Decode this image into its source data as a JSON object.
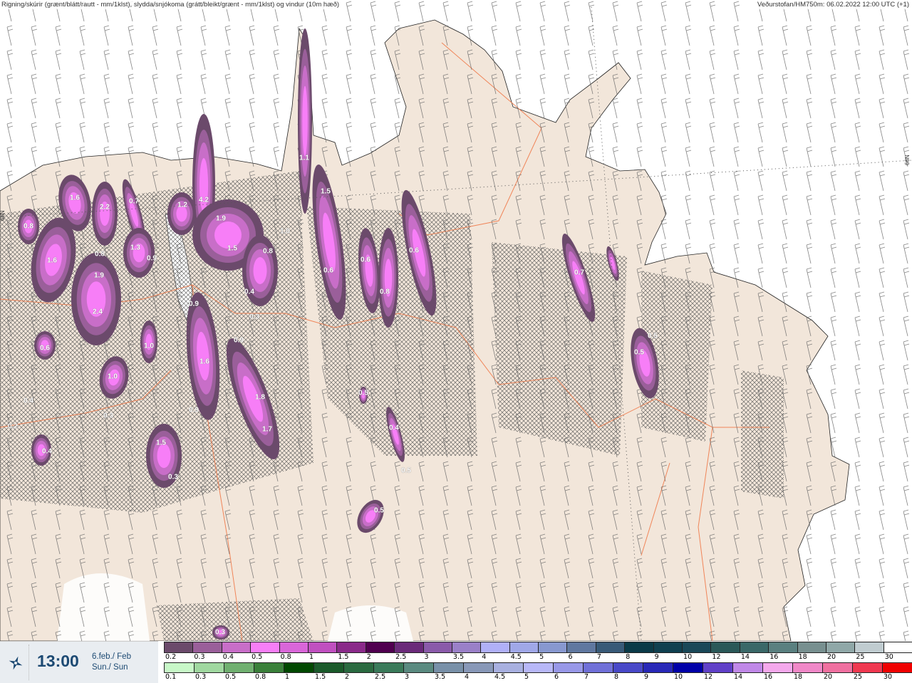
{
  "header": {
    "title": "Rigning/skúrir (grænt/blátt/rautt - mm/1klst), slydda/snjókoma (grátt/bleikt/grænt - mm/1klst) og vindur (10m hæð)",
    "source": "Veðurstofan/HM750m: 06.02.2022 12:00 UTC (+1)"
  },
  "map": {
    "lat_label_left": "66N",
    "lat_label_right": "66N",
    "colors": {
      "land": "#f2e6da",
      "sea": "#ffffff",
      "roads": "#f07a4a",
      "coast": "#222222"
    },
    "precip_values": [
      "1.6",
      "2.2",
      "0.7",
      "1.2",
      "4.2",
      "1.9",
      "0.8",
      "1.3",
      "0.9",
      "1.5",
      "0.8",
      "1.6",
      "0.8",
      "1.9",
      "2.4",
      "0.4",
      "0.3",
      "0.9",
      "0.9",
      "0.6",
      "1.0",
      "1.6",
      "1.0",
      "0.9",
      "1.8",
      "1.7",
      "0.3",
      "0.4",
      "0.2",
      "0.4",
      "1.5",
      "0.3",
      "1.1",
      "1.5",
      "1.0",
      "0.6",
      "0.6",
      "0.8",
      "0.6",
      "0.7",
      "0.5",
      "0.5",
      "0.5",
      "0.4",
      "0.5",
      "0.5",
      "0.3"
    ]
  },
  "panel": {
    "icon": "compass-star-icon",
    "time": "13:00",
    "date_line1": "6.feb./ Feb",
    "date_line2": "Sun./ Sun"
  },
  "legend": {
    "snow": {
      "labels": [
        "0.2",
        "0.3",
        "0.4",
        "0.5",
        "0.8",
        "1",
        "1.5",
        "2",
        "2.5",
        "3",
        "3.5",
        "4",
        "4.5",
        "5",
        "6",
        "7",
        "8",
        "9",
        "10",
        "12",
        "14",
        "16",
        "18",
        "20",
        "25",
        "30"
      ],
      "colors": [
        "#6b4a6b",
        "#9a5f9a",
        "#c86ec8",
        "#f77ef7",
        "#d966d9",
        "#c050c0",
        "#8a2a8a",
        "#500050",
        "#6a2a7a",
        "#8a5aaa",
        "#9a80c8",
        "#b0b0f8",
        "#a0a8e8",
        "#8898d0",
        "#6078a0",
        "#385a78",
        "#0a3a48",
        "#104050",
        "#1a4858",
        "#2a5858",
        "#3a6868",
        "#5a8080",
        "#789090",
        "#90a8a8",
        "#c0ccd0",
        "#ffffff"
      ]
    },
    "rain": {
      "labels": [
        "0.1",
        "0.3",
        "0.5",
        "0.8",
        "1",
        "1.5",
        "2",
        "2.5",
        "3",
        "3.5",
        "4",
        "4.5",
        "5",
        "6",
        "7",
        "8",
        "9",
        "10",
        "12",
        "14",
        "16",
        "18",
        "20",
        "25",
        "30"
      ],
      "colors": [
        "#c8f8c8",
        "#a0d8a0",
        "#70b070",
        "#3a803a",
        "#004800",
        "#1a5a2a",
        "#2a6a40",
        "#3a7a5a",
        "#5a8a80",
        "#7890a8",
        "#8898b8",
        "#a8b0e0",
        "#b8b8f8",
        "#9898e8",
        "#7070d8",
        "#4848c8",
        "#2828b8",
        "#0000a8",
        "#6040c8",
        "#c088e8",
        "#f4a8ec",
        "#f088c8",
        "#f070a0",
        "#f03850",
        "#f00000"
      ]
    }
  }
}
